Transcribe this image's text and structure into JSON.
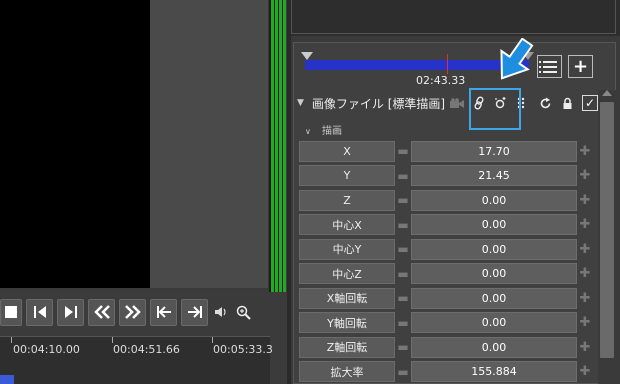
{
  "transport": {
    "zoom_icon": "magnifier-plus-icon",
    "volume_icon": "speaker-icon"
  },
  "ruler": {
    "times": [
      "00:04:10.00",
      "00:04:51.66",
      "00:05:33.3"
    ]
  },
  "mini_timeline": {
    "current_time": "02:43.33"
  },
  "object": {
    "title": "画像ファイル [標準描画]",
    "section": "描画",
    "checkbox_checked": "✓"
  },
  "params": [
    {
      "name": "X",
      "value": "17.70"
    },
    {
      "name": "Y",
      "value": "21.45"
    },
    {
      "name": "Z",
      "value": "0.00"
    },
    {
      "name": "中心X",
      "value": "0.00"
    },
    {
      "name": "中心Y",
      "value": "0.00"
    },
    {
      "name": "中心Z",
      "value": "0.00"
    },
    {
      "name": "X軸回転",
      "value": "0.00"
    },
    {
      "name": "Y軸回転",
      "value": "0.00"
    },
    {
      "name": "Z軸回転",
      "value": "0.00"
    },
    {
      "name": "拡大率",
      "value": "155.884"
    }
  ],
  "colors": {
    "timeline_bar": "#2632c8",
    "level_meter": "#22aa22",
    "highlight": "#3ba7e8"
  }
}
